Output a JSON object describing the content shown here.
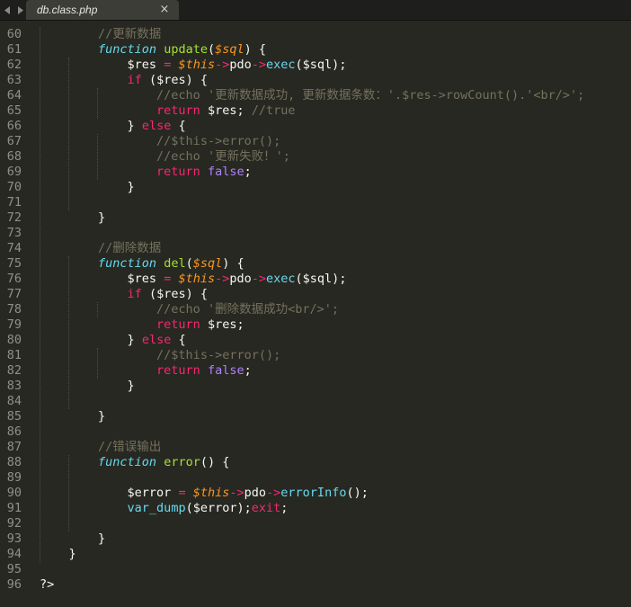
{
  "tab": {
    "title": "db.class.php",
    "close_glyph": "×",
    "nav_left_icon": "chevron-left-icon",
    "nav_right_icon": "chevron-right-icon"
  },
  "theme": {
    "background": "#272822",
    "gutter_text": "#8f908a",
    "text": "#f8f8f2",
    "comment": "#75715e",
    "keyword": "#f92672",
    "storage": "#66d9ef",
    "function_name": "#a6e22e",
    "parameter": "#fd971f",
    "constant": "#ae81ff",
    "string": "#e6db74"
  },
  "editor": {
    "lines": [
      {
        "n": "60",
        "t": [
          [
            "        ",
            "p"
          ],
          [
            "//更新数据",
            "c"
          ]
        ]
      },
      {
        "n": "61",
        "t": [
          [
            "        ",
            "p"
          ],
          [
            "function",
            "si"
          ],
          [
            " ",
            "p"
          ],
          [
            "update",
            "f"
          ],
          [
            "(",
            "p"
          ],
          [
            "$sql",
            "ai"
          ],
          [
            ") {",
            "p"
          ]
        ]
      },
      {
        "n": "62",
        "t": [
          [
            "            ",
            "p"
          ],
          [
            "$res ",
            "p"
          ],
          [
            "=",
            "k"
          ],
          [
            " ",
            "p"
          ],
          [
            "$this",
            "ti"
          ],
          [
            "->",
            "k"
          ],
          [
            "pdo",
            "p"
          ],
          [
            "->",
            "k"
          ],
          [
            "exec",
            "s"
          ],
          [
            "($sql);",
            "p"
          ]
        ]
      },
      {
        "n": "63",
        "t": [
          [
            "            ",
            "p"
          ],
          [
            "if",
            "k"
          ],
          [
            " ($res) {",
            "p"
          ]
        ]
      },
      {
        "n": "64",
        "t": [
          [
            "                ",
            "p"
          ],
          [
            "//echo '更新数据成功, 更新数据条数：'.$res->rowCount().'<br/>';",
            "c"
          ]
        ]
      },
      {
        "n": "65",
        "t": [
          [
            "                ",
            "p"
          ],
          [
            "return",
            "k"
          ],
          [
            " $res; ",
            "p"
          ],
          [
            "//true",
            "c"
          ]
        ]
      },
      {
        "n": "66",
        "t": [
          [
            "            ",
            "p"
          ],
          [
            "} ",
            "p"
          ],
          [
            "else",
            "k"
          ],
          [
            " {",
            "p"
          ]
        ]
      },
      {
        "n": "67",
        "t": [
          [
            "                ",
            "p"
          ],
          [
            "//$this->error();",
            "c"
          ]
        ]
      },
      {
        "n": "68",
        "t": [
          [
            "                ",
            "p"
          ],
          [
            "//echo '更新失败！';",
            "c"
          ]
        ]
      },
      {
        "n": "69",
        "t": [
          [
            "                ",
            "p"
          ],
          [
            "return",
            "k"
          ],
          [
            " ",
            "p"
          ],
          [
            "false",
            "v"
          ],
          [
            ";",
            "p"
          ]
        ]
      },
      {
        "n": "70",
        "t": [
          [
            "            ",
            "p"
          ],
          [
            "}",
            "p"
          ]
        ]
      },
      {
        "n": "71",
        "t": []
      },
      {
        "n": "72",
        "t": [
          [
            "        ",
            "p"
          ],
          [
            "}",
            "p"
          ]
        ]
      },
      {
        "n": "73",
        "t": []
      },
      {
        "n": "74",
        "t": [
          [
            "        ",
            "p"
          ],
          [
            "//删除数据",
            "c"
          ]
        ]
      },
      {
        "n": "75",
        "t": [
          [
            "        ",
            "p"
          ],
          [
            "function",
            "si"
          ],
          [
            " ",
            "p"
          ],
          [
            "del",
            "f"
          ],
          [
            "(",
            "p"
          ],
          [
            "$sql",
            "ai"
          ],
          [
            ") {",
            "p"
          ]
        ]
      },
      {
        "n": "76",
        "t": [
          [
            "            ",
            "p"
          ],
          [
            "$res ",
            "p"
          ],
          [
            "=",
            "k"
          ],
          [
            " ",
            "p"
          ],
          [
            "$this",
            "ti"
          ],
          [
            "->",
            "k"
          ],
          [
            "pdo",
            "p"
          ],
          [
            "->",
            "k"
          ],
          [
            "exec",
            "s"
          ],
          [
            "($sql);",
            "p"
          ]
        ]
      },
      {
        "n": "77",
        "t": [
          [
            "            ",
            "p"
          ],
          [
            "if",
            "k"
          ],
          [
            " ($res) {",
            "p"
          ]
        ]
      },
      {
        "n": "78",
        "t": [
          [
            "                ",
            "p"
          ],
          [
            "//echo '删除数据成功<br/>';",
            "c"
          ]
        ]
      },
      {
        "n": "79",
        "t": [
          [
            "                ",
            "p"
          ],
          [
            "return",
            "k"
          ],
          [
            " $res;",
            "p"
          ]
        ]
      },
      {
        "n": "80",
        "t": [
          [
            "            ",
            "p"
          ],
          [
            "} ",
            "p"
          ],
          [
            "else",
            "k"
          ],
          [
            " {",
            "p"
          ]
        ]
      },
      {
        "n": "81",
        "t": [
          [
            "                ",
            "p"
          ],
          [
            "//$this->error();",
            "c"
          ]
        ]
      },
      {
        "n": "82",
        "t": [
          [
            "                ",
            "p"
          ],
          [
            "return",
            "k"
          ],
          [
            " ",
            "p"
          ],
          [
            "false",
            "v"
          ],
          [
            ";",
            "p"
          ]
        ]
      },
      {
        "n": "83",
        "t": [
          [
            "            ",
            "p"
          ],
          [
            "}",
            "p"
          ]
        ]
      },
      {
        "n": "84",
        "t": []
      },
      {
        "n": "85",
        "t": [
          [
            "        ",
            "p"
          ],
          [
            "}",
            "p"
          ]
        ]
      },
      {
        "n": "86",
        "t": []
      },
      {
        "n": "87",
        "t": [
          [
            "        ",
            "p"
          ],
          [
            "//错误输出",
            "c"
          ]
        ]
      },
      {
        "n": "88",
        "t": [
          [
            "        ",
            "p"
          ],
          [
            "function",
            "si"
          ],
          [
            " ",
            "p"
          ],
          [
            "error",
            "f"
          ],
          [
            "() {",
            "p"
          ]
        ]
      },
      {
        "n": "89",
        "t": []
      },
      {
        "n": "90",
        "t": [
          [
            "            ",
            "p"
          ],
          [
            "$error ",
            "p"
          ],
          [
            "=",
            "k"
          ],
          [
            " ",
            "p"
          ],
          [
            "$this",
            "ti"
          ],
          [
            "->",
            "k"
          ],
          [
            "pdo",
            "p"
          ],
          [
            "->",
            "k"
          ],
          [
            "errorInfo",
            "s"
          ],
          [
            "();",
            "p"
          ]
        ]
      },
      {
        "n": "91",
        "t": [
          [
            "            ",
            "p"
          ],
          [
            "var_dump",
            "s"
          ],
          [
            "($error);",
            "p"
          ],
          [
            "exit",
            "k"
          ],
          [
            ";",
            "p"
          ]
        ]
      },
      {
        "n": "92",
        "t": []
      },
      {
        "n": "93",
        "t": [
          [
            "        ",
            "p"
          ],
          [
            "}",
            "p"
          ]
        ]
      },
      {
        "n": "94",
        "t": [
          [
            "    ",
            "p"
          ],
          [
            "}",
            "p"
          ]
        ]
      },
      {
        "n": "95",
        "t": []
      },
      {
        "n": "96",
        "t": [
          [
            "?>",
            "p"
          ]
        ]
      }
    ]
  }
}
